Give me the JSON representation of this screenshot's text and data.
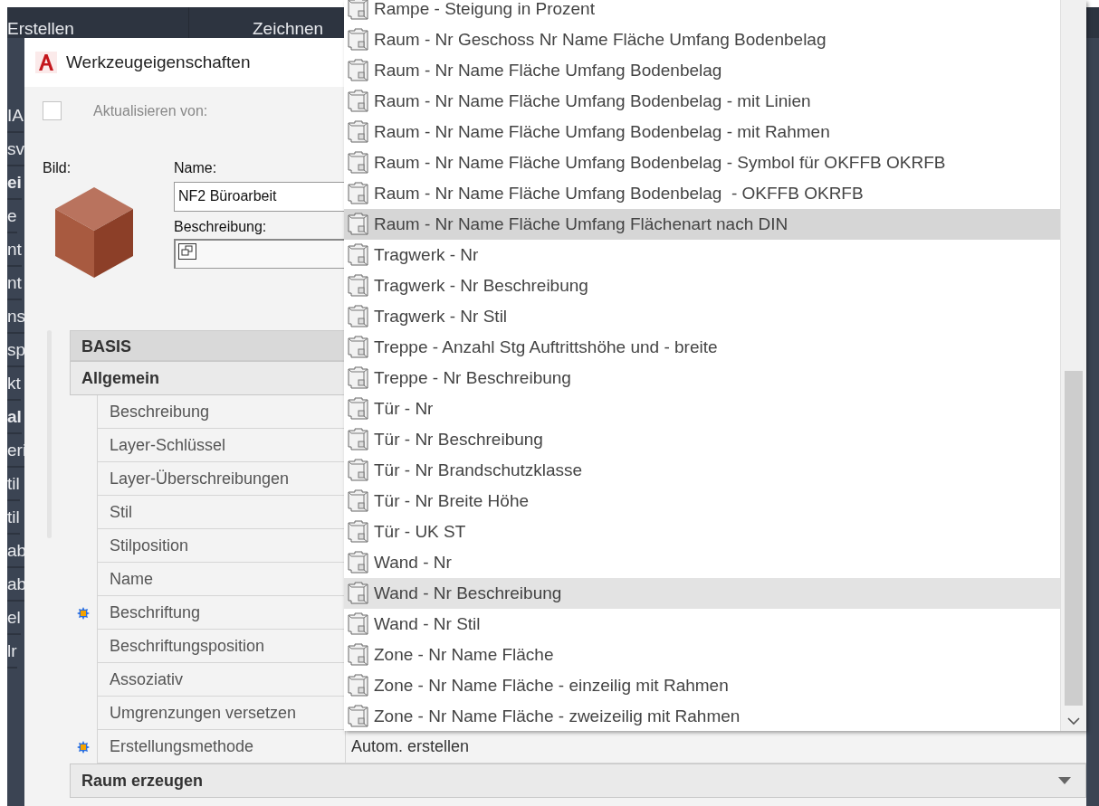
{
  "background_app": {
    "ribbon_tabs": [
      "Erstellen",
      "Zeichnen"
    ],
    "panel_fragments": [
      {
        "text": "IA",
        "bold": false
      },
      {
        "text": "sv",
        "bold": false
      },
      {
        "text": "ei",
        "bold": true
      },
      {
        "text": "e",
        "bold": false
      },
      {
        "text": "nt",
        "bold": false
      },
      {
        "text": "nt",
        "bold": false
      },
      {
        "text": "ns",
        "bold": false
      },
      {
        "text": "sp",
        "bold": false
      },
      {
        "text": "kt",
        "bold": false
      },
      {
        "text": "al",
        "bold": true
      },
      {
        "text": "eri",
        "bold": false
      },
      {
        "text": "til",
        "bold": false
      },
      {
        "text": "til",
        "bold": false
      },
      {
        "text": "ab",
        "bold": false
      },
      {
        "text": "ab",
        "bold": false
      },
      {
        "text": "el",
        "bold": false
      },
      {
        "text": "lr",
        "bold": false
      }
    ]
  },
  "window": {
    "title": "Werkzeugeigenschaften"
  },
  "update_from": {
    "label": "Aktualisieren von:",
    "checked": false,
    "disabled": true
  },
  "image": {
    "label": "Bild:"
  },
  "name": {
    "label": "Name:",
    "value": "NF2 Büroarbeit"
  },
  "description": {
    "label": "Beschreibung:"
  },
  "property_grid": {
    "header": "BASIS",
    "categories": [
      {
        "title": "Allgemein",
        "rows": [
          {
            "name": "Beschreibung",
            "marked": false
          },
          {
            "name": "Layer-Schlüssel",
            "marked": false
          },
          {
            "name": "Layer-Überschreibungen",
            "marked": false
          },
          {
            "name": "Stil",
            "marked": false
          },
          {
            "name": "Stilposition",
            "marked": false
          },
          {
            "name": "Name",
            "marked": false
          },
          {
            "name": "Beschriftung",
            "marked": true
          },
          {
            "name": "Beschriftungsposition",
            "marked": false
          },
          {
            "name": "Assoziativ",
            "marked": false
          },
          {
            "name": "Umgrenzungen versetzen",
            "marked": false
          },
          {
            "name": "Erstellungsmethode",
            "marked": true,
            "value": "Autom. erstellen"
          }
        ]
      },
      {
        "title": "Raum erzeugen"
      }
    ]
  },
  "dropdown_list": {
    "items": [
      {
        "label": "Rampe - Steigung in Prozent",
        "selected": false,
        "hovered": false
      },
      {
        "label": "Raum - Nr Geschoss Nr Name Fläche Umfang Bodenbelag",
        "selected": false,
        "hovered": false
      },
      {
        "label": "Raum - Nr Name Fläche Umfang Bodenbelag",
        "selected": false,
        "hovered": false
      },
      {
        "label": "Raum - Nr Name Fläche Umfang Bodenbelag - mit Linien",
        "selected": false,
        "hovered": false
      },
      {
        "label": "Raum - Nr Name Fläche Umfang Bodenbelag - mit Rahmen",
        "selected": false,
        "hovered": false
      },
      {
        "label": "Raum - Nr Name Fläche Umfang Bodenbelag - Symbol für OKFFB OKRFB",
        "selected": false,
        "hovered": false
      },
      {
        "label": "Raum - Nr Name Fläche Umfang Bodenbelag  - OKFFB OKRFB",
        "selected": false,
        "hovered": false
      },
      {
        "label": "Raum - Nr Name Fläche Umfang Flächenart nach DIN",
        "selected": true,
        "hovered": false
      },
      {
        "label": "Tragwerk - Nr",
        "selected": false,
        "hovered": false
      },
      {
        "label": "Tragwerk - Nr Beschreibung",
        "selected": false,
        "hovered": false
      },
      {
        "label": "Tragwerk - Nr Stil",
        "selected": false,
        "hovered": false
      },
      {
        "label": "Treppe - Anzahl Stg Auftrittshöhe und - breite",
        "selected": false,
        "hovered": false
      },
      {
        "label": "Treppe - Nr Beschreibung",
        "selected": false,
        "hovered": false
      },
      {
        "label": "Tür - Nr",
        "selected": false,
        "hovered": false
      },
      {
        "label": "Tür - Nr Beschreibung",
        "selected": false,
        "hovered": false
      },
      {
        "label": "Tür - Nr Brandschutzklasse",
        "selected": false,
        "hovered": false
      },
      {
        "label": "Tür - Nr Breite Höhe",
        "selected": false,
        "hovered": false
      },
      {
        "label": "Tür - UK ST",
        "selected": false,
        "hovered": false
      },
      {
        "label": "Wand - Nr",
        "selected": false,
        "hovered": false
      },
      {
        "label": "Wand - Nr Beschreibung",
        "selected": false,
        "hovered": true
      },
      {
        "label": "Wand - Nr Stil",
        "selected": false,
        "hovered": false
      },
      {
        "label": "Zone - Nr Name Fläche",
        "selected": false,
        "hovered": false
      },
      {
        "label": "Zone - Nr Name Fläche - einzeilig mit Rahmen",
        "selected": false,
        "hovered": false
      },
      {
        "label": "Zone - Nr Name Fläche - zweizeilig mit Rahmen",
        "selected": false,
        "hovered": false
      }
    ]
  }
}
